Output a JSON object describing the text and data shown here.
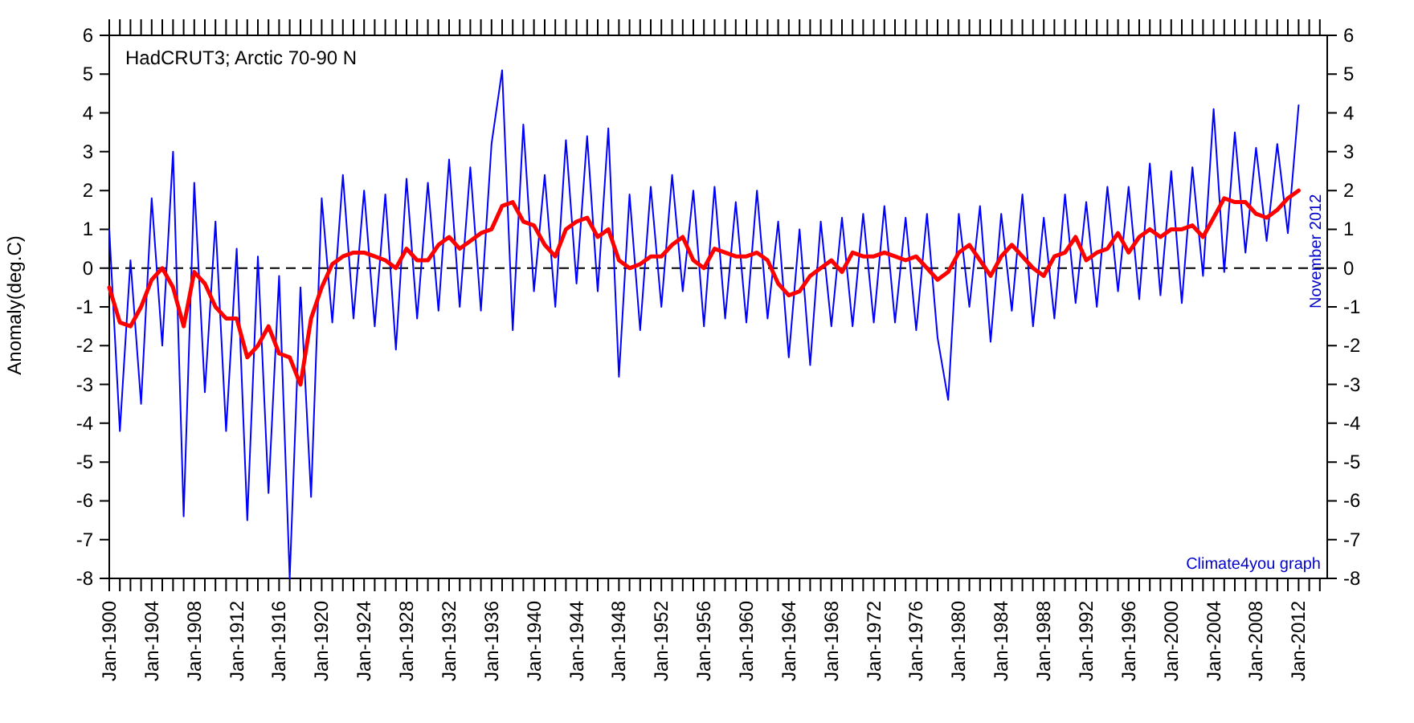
{
  "chart_data": {
    "type": "line",
    "title": "HadCRUT3; Arctic 70-90 N",
    "ylabel": "Anomaly(deg.C)",
    "categories": [
      "Jan-1900",
      null,
      null,
      null,
      "Jan-1904",
      null,
      null,
      null,
      "Jan-1908",
      null,
      null,
      null,
      "Jan-1912",
      null,
      null,
      null,
      "Jan-1916",
      null,
      null,
      null,
      "Jan-1920",
      null,
      null,
      null,
      "Jan-1924",
      null,
      null,
      null,
      "Jan-1928",
      null,
      null,
      null,
      "Jan-1932",
      null,
      null,
      null,
      "Jan-1936",
      null,
      null,
      null,
      "Jan-1940",
      null,
      null,
      null,
      "Jan-1944",
      null,
      null,
      null,
      "Jan-1948",
      null,
      null,
      null,
      "Jan-1952",
      null,
      null,
      null,
      "Jan-1956",
      null,
      null,
      null,
      "Jan-1960",
      null,
      null,
      null,
      "Jan-1964",
      null,
      null,
      null,
      "Jan-1968",
      null,
      null,
      null,
      "Jan-1972",
      null,
      null,
      null,
      "Jan-1976",
      null,
      null,
      null,
      "Jan-1980",
      null,
      null,
      null,
      "Jan-1984",
      null,
      null,
      null,
      "Jan-1988",
      null,
      null,
      null,
      "Jan-1992",
      null,
      null,
      null,
      "Jan-1996",
      null,
      null,
      null,
      "Jan-2000",
      null,
      null,
      null,
      "Jan-2004",
      null,
      null,
      null,
      "Jan-2008",
      null,
      null,
      null,
      "Jan-2012"
    ],
    "series": [
      {
        "color": "#0000ff",
        "values": [
          1.0,
          -4.2,
          0.2,
          -3.5,
          1.8,
          -2.0,
          3.0,
          -6.4,
          2.2,
          -3.2,
          1.2,
          -4.2,
          0.5,
          -6.5,
          0.3,
          -5.8,
          -0.2,
          -8.0,
          -0.5,
          -5.9,
          1.8,
          -1.4,
          2.4,
          -1.3,
          2.0,
          -1.5,
          1.9,
          -2.1,
          2.3,
          -1.3,
          2.2,
          -1.1,
          2.8,
          -1.0,
          2.6,
          -1.1,
          3.2,
          5.1,
          -1.6,
          3.7,
          -0.6,
          2.4,
          -1.0,
          3.3,
          -0.4,
          3.4,
          -0.6,
          3.6,
          -2.8,
          1.9,
          -1.6,
          2.1,
          -1.0,
          2.4,
          -0.6,
          2.0,
          -1.5,
          2.1,
          -1.3,
          1.7,
          -1.4,
          2.0,
          -1.3,
          1.2,
          -2.3,
          1.0,
          -2.5,
          1.2,
          -1.5,
          1.3,
          -1.5,
          1.4,
          -1.4,
          1.6,
          -1.4,
          1.3,
          -1.6,
          1.4,
          -1.8,
          -3.4,
          1.4,
          -1.0,
          1.6,
          -1.9,
          1.4,
          -1.1,
          1.9,
          -1.5,
          1.3,
          -1.3,
          1.9,
          -0.9,
          1.7,
          -1.0,
          2.1,
          -0.6,
          2.1,
          -0.8,
          2.7,
          -0.7,
          2.5,
          -0.9,
          2.6,
          -0.2,
          4.1,
          -0.1,
          3.5,
          0.4,
          3.1,
          0.7,
          3.2,
          0.9,
          4.2
        ]
      },
      {
        "color": "#ff0000",
        "values": [
          -0.5,
          -1.4,
          -1.5,
          -1.0,
          -0.3,
          0.0,
          -0.5,
          -1.5,
          -0.1,
          -0.4,
          -1.0,
          -1.3,
          -1.3,
          -2.3,
          -2.0,
          -1.5,
          -2.2,
          -2.3,
          -3.0,
          -1.3,
          -0.5,
          0.1,
          0.3,
          0.4,
          0.4,
          0.3,
          0.2,
          0.0,
          0.5,
          0.2,
          0.2,
          0.6,
          0.8,
          0.5,
          0.7,
          0.9,
          1.0,
          1.6,
          1.7,
          1.2,
          1.1,
          0.6,
          0.3,
          1.0,
          1.2,
          1.3,
          0.8,
          1.0,
          0.2,
          0.0,
          0.1,
          0.3,
          0.3,
          0.6,
          0.8,
          0.2,
          0.0,
          0.5,
          0.4,
          0.3,
          0.3,
          0.4,
          0.2,
          -0.4,
          -0.7,
          -0.6,
          -0.2,
          0.0,
          0.2,
          -0.1,
          0.4,
          0.3,
          0.3,
          0.4,
          0.3,
          0.2,
          0.3,
          0.0,
          -0.3,
          -0.1,
          0.4,
          0.6,
          0.2,
          -0.2,
          0.3,
          0.6,
          0.3,
          0.0,
          -0.2,
          0.3,
          0.4,
          0.8,
          0.2,
          0.4,
          0.5,
          0.9,
          0.4,
          0.8,
          1.0,
          0.8,
          1.0,
          1.0,
          1.1,
          0.8,
          1.3,
          1.8,
          1.7,
          1.7,
          1.4,
          1.3,
          1.5,
          1.8,
          2.0
        ]
      }
    ],
    "ylim": [
      -8,
      6
    ],
    "yticks": [
      -8,
      -7,
      -6,
      -5,
      -4,
      -3,
      -2,
      -1,
      0,
      1,
      2,
      3,
      4,
      5,
      6
    ],
    "annotations": [
      "-8",
      "-7",
      "-6",
      "-5",
      "-4",
      "-3",
      "-2",
      "-1",
      "0",
      "1",
      "2",
      "3",
      "4",
      "5",
      "6",
      "November 2012",
      "Climate4you graph"
    ]
  }
}
